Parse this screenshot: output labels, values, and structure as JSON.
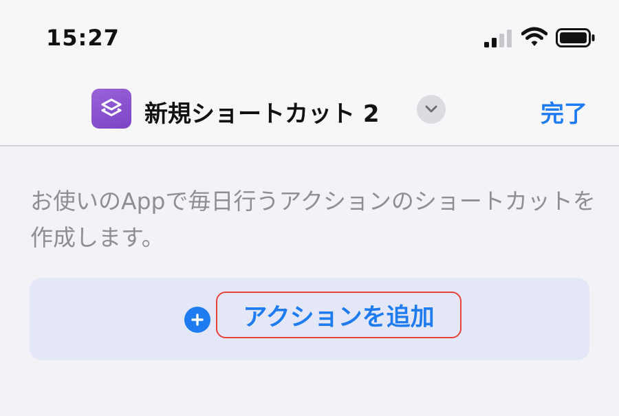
{
  "status_bar": {
    "time": "15:27",
    "signal_icon": "cellular-signal-icon",
    "wifi_icon": "wifi-icon",
    "battery_icon": "battery-icon"
  },
  "nav_bar": {
    "app_icon": "shortcuts-layers-icon",
    "title": "新規ショートカット 2",
    "chevron_icon": "chevron-down-icon",
    "done_label": "完了"
  },
  "description": "お使いのAppで毎日行うアクションのショートカットを作成します。",
  "add_action": {
    "icon": "plus-circle-icon",
    "label": "アクションを追加"
  },
  "colors": {
    "accent": "#1f7cf0",
    "app_icon": "#8b52cf",
    "highlight_border": "#e9423a",
    "card_background": "#e4e7f8",
    "page_background": "#f2f2f7"
  }
}
